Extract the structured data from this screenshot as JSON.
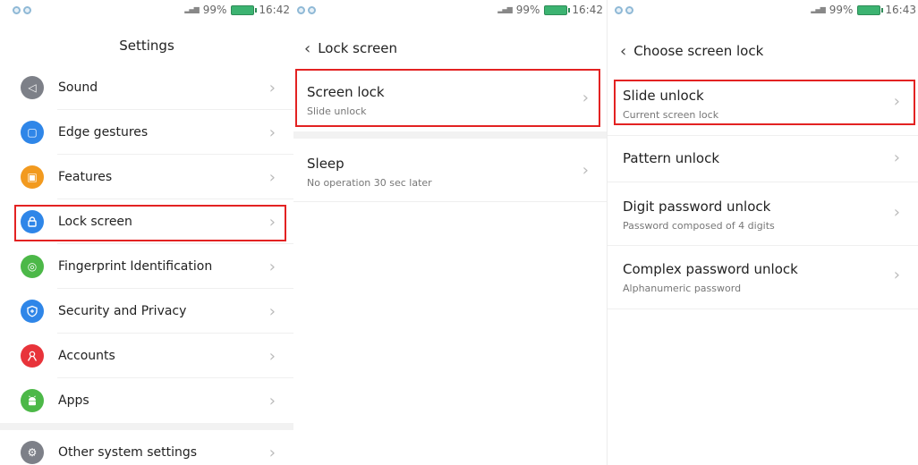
{
  "screen1": {
    "status": {
      "battery": "99%",
      "time": "16:42"
    },
    "title": "Settings",
    "items": [
      {
        "label": "Sound",
        "icon": "speaker-icon",
        "color": "#7d8088",
        "glyph": "◁"
      },
      {
        "label": "Edge gestures",
        "icon": "edge-gestures-icon",
        "color": "#2f86e8",
        "glyph": "▢"
      },
      {
        "label": "Features",
        "icon": "features-icon",
        "color": "#f29a1f",
        "glyph": "▣"
      },
      {
        "label": "Lock screen",
        "icon": "lock-icon",
        "color": "#2f86e8",
        "glyph": "🔒︎"
      },
      {
        "label": "Fingerprint Identification",
        "icon": "fingerprint-icon",
        "color": "#4cb848",
        "glyph": "◎"
      },
      {
        "label": "Security and Privacy",
        "icon": "shield-icon",
        "color": "#2f86e8",
        "glyph": "⛉"
      },
      {
        "label": "Accounts",
        "icon": "account-icon",
        "color": "#e8333a",
        "glyph": "Ȣ"
      },
      {
        "label": "Apps",
        "icon": "android-icon",
        "color": "#4cb848",
        "glyph": "☗"
      },
      {
        "label": "Other system settings",
        "icon": "gear-icon",
        "color": "#7d8088",
        "glyph": "⚙"
      }
    ],
    "chevron": "›"
  },
  "screen2": {
    "status": {
      "battery": "99%",
      "time": "16:42"
    },
    "back": "‹",
    "title": "Lock screen",
    "items": [
      {
        "title": "Screen lock",
        "sub": "Slide unlock"
      },
      {
        "title": "Sleep",
        "sub": "No operation 30 sec later"
      }
    ],
    "chevron": "›"
  },
  "screen3": {
    "status": {
      "battery": "99%",
      "time": "16:43"
    },
    "back": "‹",
    "title": "Choose screen lock",
    "items": [
      {
        "title": "Slide unlock",
        "sub": "Current screen lock"
      },
      {
        "title": "Pattern unlock",
        "sub": ""
      },
      {
        "title": "Digit password unlock",
        "sub": "Password composed of 4 digits"
      },
      {
        "title": "Complex password unlock",
        "sub": "Alphanumeric password"
      }
    ],
    "chevron": "›"
  },
  "colors": {
    "highlight": "#e32222",
    "accent_blue": "#2f86e8"
  }
}
